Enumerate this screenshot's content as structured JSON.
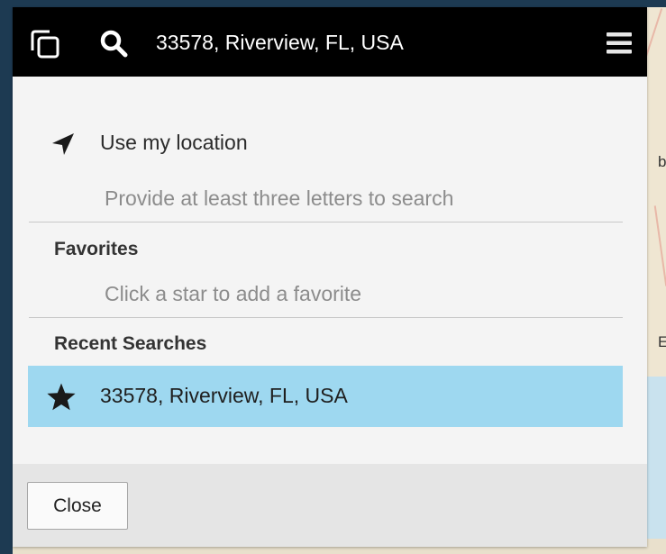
{
  "colors": {
    "topbar_bg": "#000000",
    "panel_bg": "#f4f4f4",
    "selected_row_bg": "#9ed8f0",
    "footer_bg": "#e5e5e5",
    "page_bg": "#1d3a52"
  },
  "topbar": {
    "layers_icon": "layers-icon",
    "search_icon": "search-icon",
    "search_value": "33578, Riverview, FL, USA",
    "menu_icon": "hamburger-menu-icon"
  },
  "location": {
    "icon": "location-arrow-icon",
    "label": "Use my location",
    "hint": "Provide at least three letters to search"
  },
  "favorites": {
    "heading": "Favorites",
    "hint": "Click a star to add a favorite"
  },
  "recent": {
    "heading": "Recent Searches",
    "items": [
      {
        "icon": "star-icon",
        "label": "33578, Riverview, FL, USA",
        "favorited": true
      }
    ]
  },
  "footer": {
    "close_label": "Close"
  },
  "map": {
    "edge_letters": [
      "b",
      "E"
    ]
  }
}
